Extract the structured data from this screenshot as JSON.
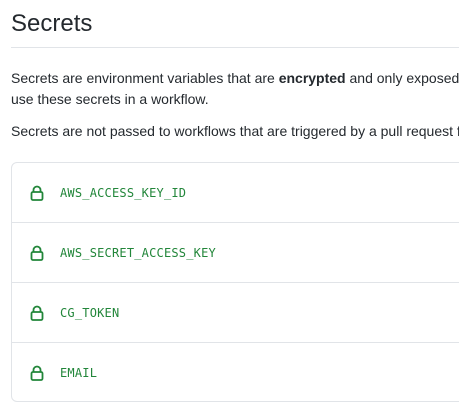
{
  "header": {
    "title": "Secrets"
  },
  "intro": {
    "line1_prefix": "Secrets are environment variables that are ",
    "line1_bold": "encrypted",
    "line1_suffix": " and only exposed t",
    "line2": "use these secrets in a workflow.",
    "line3": "Secrets are not passed to workflows that are triggered by a pull request f"
  },
  "secrets": {
    "items": [
      {
        "name": "AWS_ACCESS_KEY_ID",
        "icon": "lock-icon"
      },
      {
        "name": "AWS_SECRET_ACCESS_KEY",
        "icon": "lock-icon"
      },
      {
        "name": "CG_TOKEN",
        "icon": "lock-icon"
      },
      {
        "name": "EMAIL",
        "icon": "lock-icon"
      }
    ]
  },
  "colors": {
    "secret_name": "#22863a",
    "lock_icon": "#22863a",
    "border": "#e1e4e8",
    "text": "#24292e"
  }
}
